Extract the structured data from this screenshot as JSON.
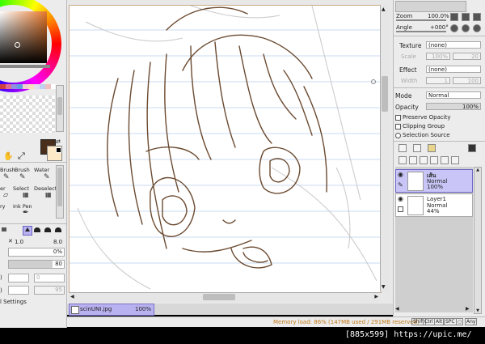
{
  "tools": {
    "row1": [
      "Brush",
      "Brush",
      "Water"
    ],
    "row2": [
      "er",
      "Select",
      "Deselect"
    ],
    "row3": [
      "ry",
      "Ink Pen"
    ],
    "size_value": "1.0",
    "size_max": "8.0",
    "percent": "0%",
    "density": "80",
    "val1": "0",
    "val2": "95",
    "settings": "l Settings"
  },
  "swatch_colors": [
    "#d04040",
    "#e07090",
    "#9090e0",
    "#60a0e0",
    "#f0d0d0",
    "#f8e0c0",
    "#e0e0f0",
    "#c0d0f0",
    "#f0c0c0",
    "#ffffff"
  ],
  "colors": {
    "fg": "#4a2e1c",
    "bg": "#fde8c8"
  },
  "navigator": {
    "zoom_label": "Zoom",
    "zoom_value": "100.0%",
    "angle_label": "Angle",
    "angle_value": "+000°"
  },
  "texture": {
    "label": "Texture",
    "value": "(none)",
    "sub_label": "Scale",
    "sub_value": "100%",
    "sub_num": "20"
  },
  "effect": {
    "label": "Effect",
    "value": "(none)",
    "sub_label": "Width",
    "sub_value": "1",
    "sub_num": "100"
  },
  "mode": {
    "label": "Mode",
    "value": "Normal"
  },
  "opacity": {
    "label": "Opacity",
    "value": "100%"
  },
  "options": {
    "preserve_opacity": "Preserve Opacity",
    "clipping_group": "Clipping Group",
    "selection_source": "Selection Source"
  },
  "layers": [
    {
      "name": "เส้น",
      "mode": "Normal",
      "opacity": "100%"
    },
    {
      "name": "Layer1",
      "mode": "Normal",
      "opacity": "44%"
    }
  ],
  "document": {
    "name": "scinUNI.jpg",
    "zoom": "100%"
  },
  "status": {
    "memory": "Memory load: 86% (147MB used / 291MB reserved)",
    "keys": [
      "Shift",
      "Ctrl",
      "Alt",
      "SPC",
      "○",
      "Any"
    ]
  },
  "watermark": "[885x599] https://upic.me/"
}
